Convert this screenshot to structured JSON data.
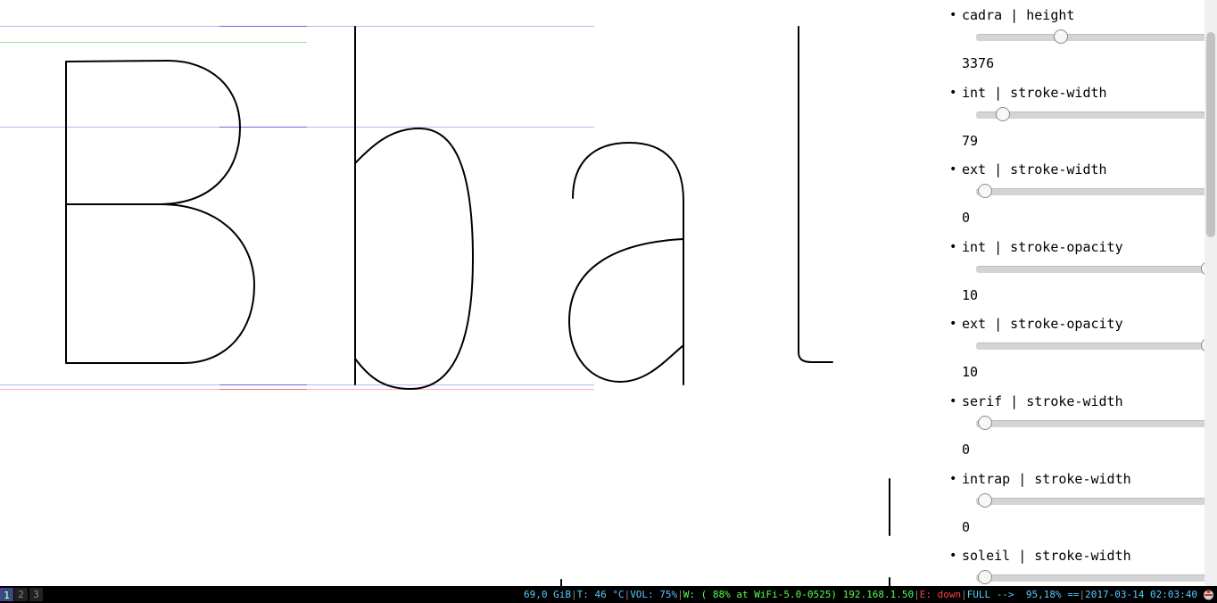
{
  "controls": [
    {
      "label": "cadra | height",
      "value": "3376",
      "slider_fraction": 0.34
    },
    {
      "label": "int | stroke-width",
      "value": "79",
      "slider_fraction": 0.08
    },
    {
      "label": "ext | stroke-width",
      "value": "0",
      "slider_fraction": 0.0
    },
    {
      "label": "int | stroke-opacity",
      "value": "10",
      "slider_fraction": 1.0
    },
    {
      "label": "ext | stroke-opacity",
      "value": "10",
      "slider_fraction": 1.0
    },
    {
      "label": "serif | stroke-width",
      "value": "0",
      "slider_fraction": 0.0
    },
    {
      "label": "intrap | stroke-width",
      "value": "0",
      "slider_fraction": 0.0
    },
    {
      "label": "soleil | stroke-width",
      "value": "",
      "slider_fraction": 0.0
    }
  ],
  "statusbar": {
    "workspaces": [
      "1",
      "2",
      "3"
    ],
    "active_workspace": "1",
    "disk": "69,0 GiB",
    "temp": "T: 46 °C",
    "volume": "VOL: 75%",
    "wireless": "W: ( 88% at WiFi-5.0-0525) 192.168.1.50",
    "ethernet": "E: down",
    "battery": "FULL -->  95,18% ==",
    "datetime": "2017-03-14 02:03:40"
  },
  "colors": {
    "guide_blue": "#a0a0ff",
    "guide_green": "#90e090",
    "guide_red": "#ff9090",
    "status_green": "#55ff55",
    "status_cyan": "#55ccff",
    "status_red": "#ff4444"
  }
}
